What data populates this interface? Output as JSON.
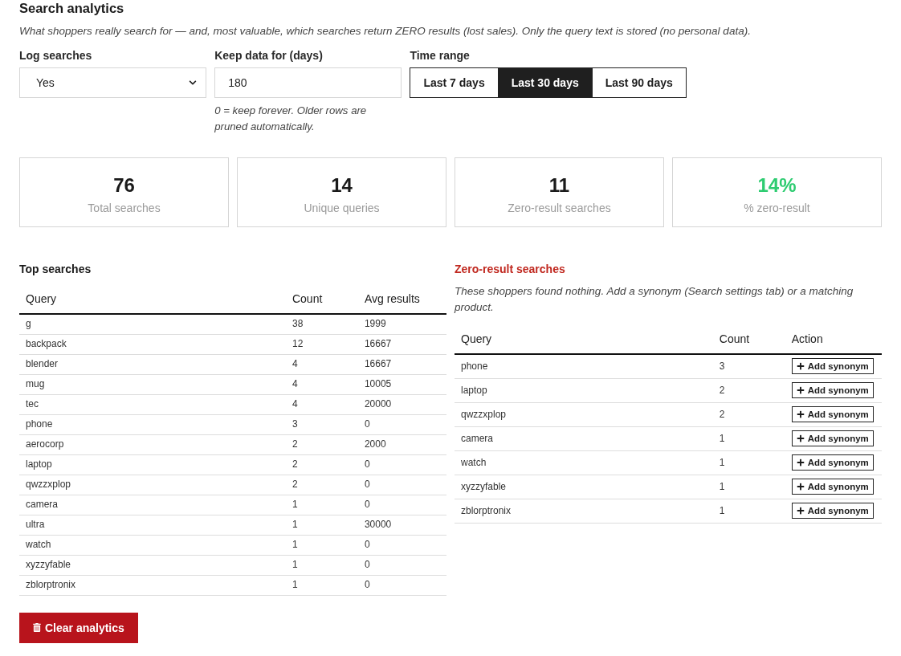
{
  "page": {
    "title": "Search analytics",
    "description": "What shoppers really search for — and, most valuable, which searches return ZERO results (lost sales). Only the query text is stored (no personal data)."
  },
  "settings": {
    "log_searches": {
      "label": "Log searches",
      "value": "Yes"
    },
    "keep_days": {
      "label": "Keep data for (days)",
      "value": "180",
      "help": "0 = keep forever. Older rows are pruned automatically."
    },
    "time_range": {
      "label": "Time range",
      "options": [
        {
          "label": "Last 7 days",
          "selected": false
        },
        {
          "label": "Last 30 days",
          "selected": true
        },
        {
          "label": "Last 90 days",
          "selected": false
        }
      ]
    }
  },
  "stats": [
    {
      "value": "76",
      "label": "Total searches",
      "color": "#1a1a1a"
    },
    {
      "value": "14",
      "label": "Unique queries",
      "color": "#1a1a1a"
    },
    {
      "value": "11",
      "label": "Zero-result searches",
      "color": "#1a1a1a"
    },
    {
      "value": "14%",
      "label": "% zero-result",
      "color": "#2ecc71"
    }
  ],
  "top_searches": {
    "title": "Top searches",
    "columns": [
      "Query",
      "Count",
      "Avg results"
    ],
    "rows": [
      {
        "query": "g",
        "count": "38",
        "avg_results": "1999"
      },
      {
        "query": "backpack",
        "count": "12",
        "avg_results": "16667"
      },
      {
        "query": "blender",
        "count": "4",
        "avg_results": "16667"
      },
      {
        "query": "mug",
        "count": "4",
        "avg_results": "10005"
      },
      {
        "query": "tec",
        "count": "4",
        "avg_results": "20000"
      },
      {
        "query": "phone",
        "count": "3",
        "avg_results": "0"
      },
      {
        "query": "aerocorp",
        "count": "2",
        "avg_results": "2000"
      },
      {
        "query": "laptop",
        "count": "2",
        "avg_results": "0"
      },
      {
        "query": "qwzzxplop",
        "count": "2",
        "avg_results": "0"
      },
      {
        "query": "camera",
        "count": "1",
        "avg_results": "0"
      },
      {
        "query": "ultra",
        "count": "1",
        "avg_results": "30000"
      },
      {
        "query": "watch",
        "count": "1",
        "avg_results": "0"
      },
      {
        "query": "xyzzyfable",
        "count": "1",
        "avg_results": "0"
      },
      {
        "query": "zblorptronix",
        "count": "1",
        "avg_results": "0"
      }
    ]
  },
  "zero_results": {
    "title": "Zero-result searches",
    "description": "These shoppers found nothing. Add a synonym (Search settings tab) or a matching product.",
    "columns": [
      "Query",
      "Count",
      "Action"
    ],
    "rows": [
      {
        "query": "phone",
        "count": "3",
        "action": "Add synonym"
      },
      {
        "query": "laptop",
        "count": "2",
        "action": "Add synonym"
      },
      {
        "query": "qwzzxplop",
        "count": "2",
        "action": "Add synonym"
      },
      {
        "query": "camera",
        "count": "1",
        "action": "Add synonym"
      },
      {
        "query": "watch",
        "count": "1",
        "action": "Add synonym"
      },
      {
        "query": "xyzzyfable",
        "count": "1",
        "action": "Add synonym"
      },
      {
        "query": "zblorptronix",
        "count": "1",
        "action": "Add synonym"
      }
    ]
  },
  "clear_button": "Clear analytics"
}
